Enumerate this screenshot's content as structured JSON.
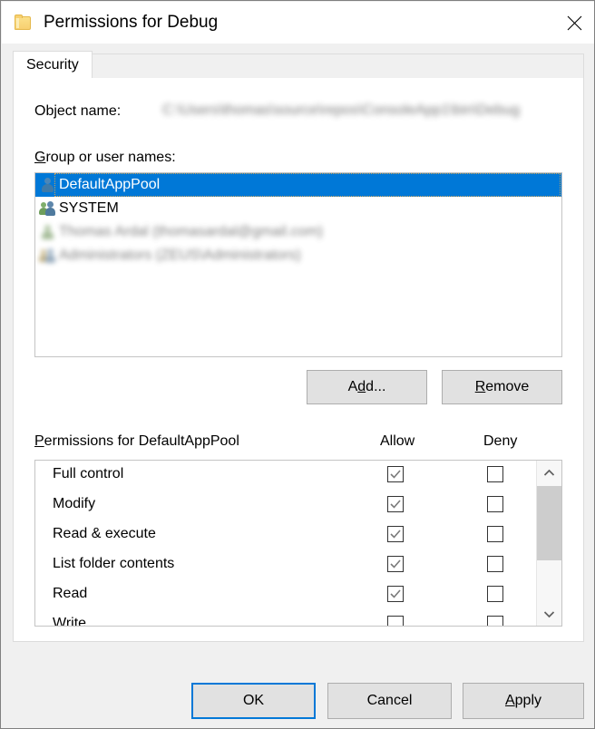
{
  "window": {
    "title": "Permissions for Debug",
    "folder_icon": "folder-icon",
    "close_icon": "close-icon"
  },
  "tabs": [
    {
      "label": "Security",
      "active": true
    }
  ],
  "object_name": {
    "label": "Object name:",
    "value": "C:\\Users\\thomas\\source\\repos\\ConsoleApp1\\bin\\Debug",
    "redacted": true
  },
  "group_list": {
    "label": "Group or user names:",
    "items": [
      {
        "name": "DefaultAppPool",
        "icon": "user-icon",
        "selected": true,
        "redacted": false
      },
      {
        "name": "SYSTEM",
        "icon": "group-icon",
        "selected": false,
        "redacted": false
      },
      {
        "name": "Thomas Ardal (thomasardal@gmail.com)",
        "icon": "user-icon",
        "selected": false,
        "redacted": true
      },
      {
        "name": "Administrators (ZEUS\\Administrators)",
        "icon": "group-icon",
        "selected": false,
        "redacted": true
      }
    ],
    "add_button": "Add...",
    "remove_button": "Remove"
  },
  "permissions": {
    "label": "Permissions for DefaultAppPool",
    "allow_column": "Allow",
    "deny_column": "Deny",
    "rows": [
      {
        "name": "Full control",
        "allow": true,
        "deny": false
      },
      {
        "name": "Modify",
        "allow": true,
        "deny": false
      },
      {
        "name": "Read & execute",
        "allow": true,
        "deny": false
      },
      {
        "name": "List folder contents",
        "allow": true,
        "deny": false
      },
      {
        "name": "Read",
        "allow": true,
        "deny": false
      },
      {
        "name": "Write",
        "allow": false,
        "deny": false
      }
    ],
    "scrollbar": {
      "up_icon": "chevron-up-icon",
      "down_icon": "chevron-down-icon"
    }
  },
  "footer": {
    "ok": "OK",
    "cancel": "Cancel",
    "apply": "Apply"
  },
  "colors": {
    "accent": "#0078d7",
    "dialog_bg": "#f0f0f0",
    "panel_bg": "#ffffff",
    "button_bg": "#e1e1e1",
    "checkmark": "#7a7a7a"
  }
}
